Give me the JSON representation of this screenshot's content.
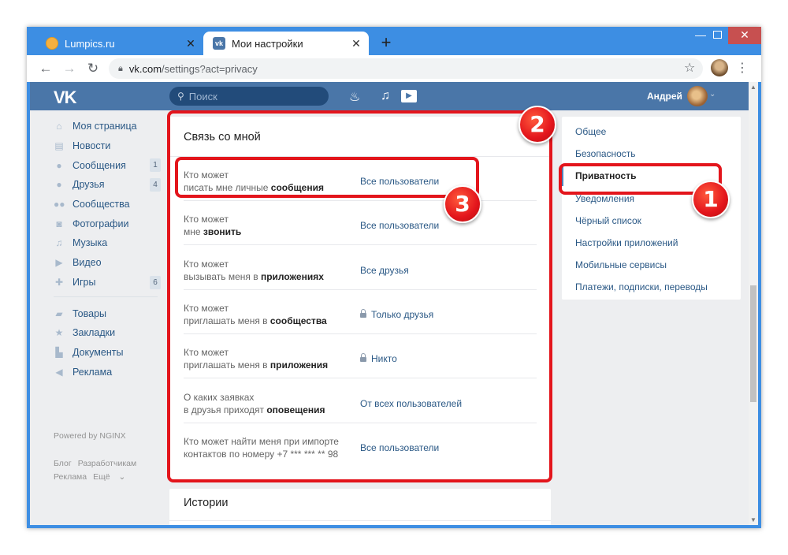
{
  "browser": {
    "tabs": [
      {
        "title": "Lumpics.ru",
        "close": "✕"
      },
      {
        "title": "Мои настройки",
        "close": "✕"
      }
    ],
    "new_tab": "+",
    "url_host": "vk.com",
    "url_path": "/settings?act=privacy",
    "window_controls": {
      "minimize": "—",
      "close": "✕"
    }
  },
  "vk": {
    "logo": "VK",
    "search_placeholder": "Поиск",
    "user_name": "Андрей",
    "left_menu": [
      {
        "label": "Моя страница",
        "icon": "home-icon"
      },
      {
        "label": "Новости",
        "icon": "news-icon"
      },
      {
        "label": "Сообщения",
        "icon": "messages-icon",
        "count": "1"
      },
      {
        "label": "Друзья",
        "icon": "friends-icon",
        "count": "4"
      },
      {
        "label": "Сообщества",
        "icon": "communities-icon"
      },
      {
        "label": "Фотографии",
        "icon": "photos-icon"
      },
      {
        "label": "Музыка",
        "icon": "music-icon"
      },
      {
        "label": "Видео",
        "icon": "video-icon"
      },
      {
        "label": "Игры",
        "icon": "games-icon",
        "count": "6"
      }
    ],
    "left_menu2": [
      {
        "label": "Товары",
        "icon": "goods-icon"
      },
      {
        "label": "Закладки",
        "icon": "bookmarks-icon"
      },
      {
        "label": "Документы",
        "icon": "documents-icon"
      },
      {
        "label": "Реклама",
        "icon": "ads-icon"
      }
    ],
    "powered": "Powered by NGINX",
    "footer": {
      "blog": "Блог",
      "dev": "Разработчикам",
      "ads": "Реклама",
      "more": "Ещё"
    }
  },
  "privacy": {
    "section_title": "Связь со мной",
    "rows": [
      {
        "line1": "Кто может",
        "line2_plain": "писать мне личные ",
        "line2_bold": "сообщения",
        "value": "Все пользователи",
        "locked": false
      },
      {
        "line1": "Кто может",
        "line2_plain": "мне ",
        "line2_bold": "звонить",
        "value": "Все пользователи",
        "locked": false
      },
      {
        "line1": "Кто может",
        "line2_plain": "вызывать меня в ",
        "line2_bold": "приложениях",
        "value": "Все друзья",
        "locked": false
      },
      {
        "line1": "Кто может",
        "line2_plain": "приглашать меня в ",
        "line2_bold": "сообщества",
        "value": "Только друзья",
        "locked": true
      },
      {
        "line1": "Кто может",
        "line2_plain": "приглашать меня в ",
        "line2_bold": "приложения",
        "value": "Никто",
        "locked": true
      },
      {
        "line1": "О каких заявках",
        "line2_plain": "в друзья приходят ",
        "line2_bold": "оповещения",
        "value": "От всех пользователей",
        "locked": false
      },
      {
        "line1": "Кто может найти меня при импорте",
        "line2_plain": "контактов по номеру +7 *** *** ** 98",
        "line2_bold": "",
        "value": "Все пользователи",
        "locked": false
      }
    ],
    "next_section_title": "Истории"
  },
  "settings_menu": {
    "items": [
      "Общее",
      "Безопасность",
      "Приватность",
      "Уведомления",
      "Чёрный список",
      "Настройки приложений",
      "Мобильные сервисы",
      "Платежи, подписки, переводы"
    ],
    "active_index": 2
  },
  "annotations": {
    "n1": "1",
    "n2": "2",
    "n3": "3",
    "color": "#e3151c"
  }
}
